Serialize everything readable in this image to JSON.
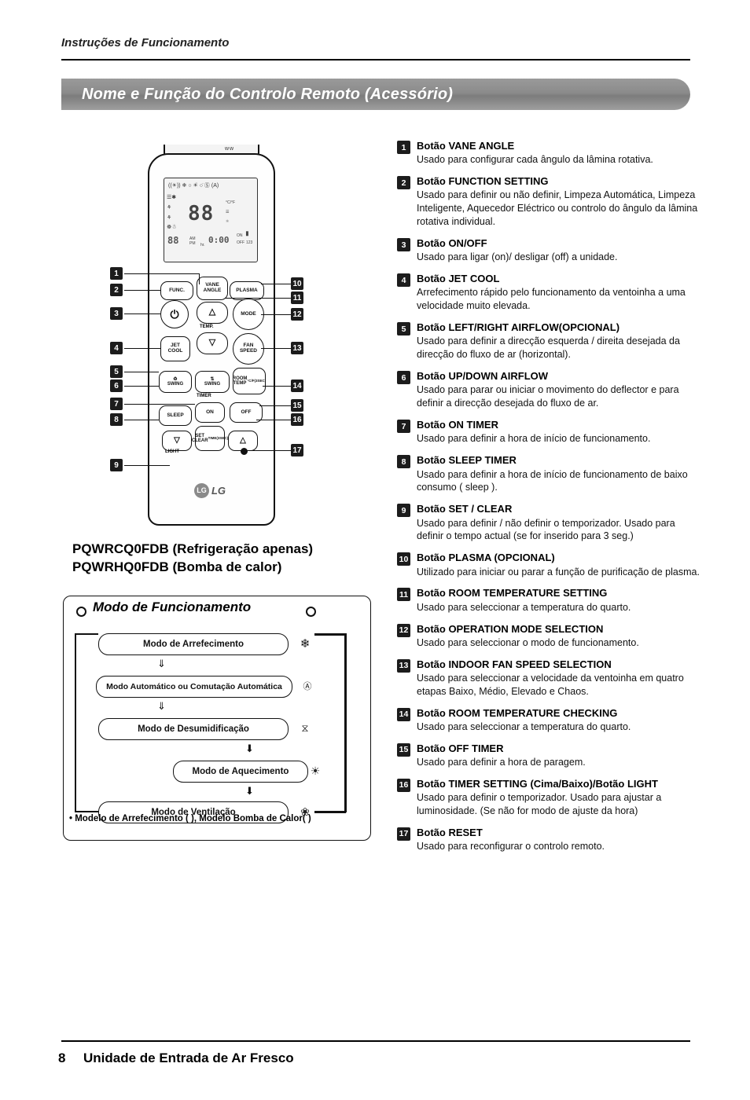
{
  "header": {
    "running_title": "Instruções de Funcionamento",
    "section_title": "Nome e Função do Controlo Remoto (Acessório)"
  },
  "footer": {
    "page_number": "8",
    "text": "Unidade de Entrada de Ar Fresco"
  },
  "remote": {
    "model_line1": "PQWRCQ0FDB (Refrigeração apenas)",
    "model_line2": "PQWRHQ0FDB (Bomba de calor)",
    "brand": "LG",
    "brand_mark": "LG",
    "lcd": {
      "main_value": "88",
      "small_value": "88",
      "unit": "°C/°F",
      "am_pm": "AM\nPM",
      "hr": "hr.",
      "time": "0:00",
      "on_label": "ON",
      "off_label": "OFF",
      "timer_numbers": "123"
    },
    "buttons": {
      "func": "FUNC.",
      "vane_angle": "VANE\nANGLE",
      "plasma": "PLASMA",
      "mode": "MODE",
      "temp": "TEMP.",
      "jet_cool": "JET\nCOOL",
      "fan_speed": "FAN\nSPEED",
      "swing": "SWING",
      "room_temp": "ROOM\nTEMP",
      "room_temp_sub": "°C/F(3SEC)",
      "timer": "TIMER",
      "on": "ON",
      "off": "OFF",
      "sleep": "SLEEP",
      "set_clear": "SET\nCLEAR",
      "set_clear_sub": "TIME(3SEC)",
      "light": "LIGHT",
      "power": "power-icon",
      "reset": "reset-hole"
    },
    "callouts": [
      "1",
      "2",
      "3",
      "4",
      "5",
      "6",
      "7",
      "8",
      "9",
      "10",
      "11",
      "12",
      "13",
      "14",
      "15",
      "16",
      "17"
    ]
  },
  "mode_diagram": {
    "title": "Modo de Funcionamento",
    "steps": [
      {
        "label": "Modo de Arrefecimento",
        "icon": "❄"
      },
      {
        "label": "Modo Automático ou Comutação Automática",
        "icon": "A"
      },
      {
        "label": "Modo de Desumidificação",
        "icon": "💧"
      },
      {
        "label": "Modo de Aquecimento",
        "icon": "☀"
      },
      {
        "label": "Modo de Ventilação",
        "icon": "✿"
      }
    ],
    "note": "• Modelo de Arrefecimento (    ), Modelo Bomba de Calor(    )"
  },
  "functions": [
    {
      "num": "1",
      "title": "Botão VANE ANGLE",
      "desc": "Usado para configurar cada ângulo da lâmina rotativa."
    },
    {
      "num": "2",
      "title": "Botão FUNCTION SETTING",
      "desc": "Usado para definir ou não definir, Limpeza Automática, Limpeza Inteligente, Aquecedor Eléctrico ou controlo do ângulo da lâmina rotativa individual."
    },
    {
      "num": "3",
      "title": "Botão ON/OFF",
      "desc": "Usado para ligar (on)/ desligar (off) a unidade."
    },
    {
      "num": "4",
      "title": "Botão JET COOL",
      "desc": "Arrefecimento rápido pelo funcionamento da ventoinha a uma velocidade muito elevada."
    },
    {
      "num": "5",
      "title": "Botão LEFT/RIGHT AIRFLOW(OPCIONAL)",
      "desc": "Usado para definir a direcção esquerda / direita desejada da direcção do fluxo de ar (horizontal)."
    },
    {
      "num": "6",
      "title": "Botão UP/DOWN AIRFLOW",
      "desc": "Usado para parar ou iniciar o movimento do deflector e para definir a direcção desejada do fluxo de ar."
    },
    {
      "num": "7",
      "title": "Botão ON TIMER",
      "desc": "Usado para definir a hora de início de funcionamento."
    },
    {
      "num": "8",
      "title": "Botão SLEEP TIMER",
      "desc": "Usado para definir a hora de início de funcionamento de baixo consumo ( sleep )."
    },
    {
      "num": "9",
      "title": "Botão SET / CLEAR",
      "desc": "Usado para definir / não definir o temporizador. Usado para definir o tempo actual (se for inserido para 3 seg.)"
    },
    {
      "num": "10",
      "title": "Botão PLASMA (OPCIONAL)",
      "desc": "Utilizado para iniciar ou parar a função de purificação de plasma."
    },
    {
      "num": "11",
      "title": "Botão ROOM TEMPERATURE SETTING",
      "desc": "Usado para seleccionar a temperatura do quarto."
    },
    {
      "num": "12",
      "title": "Botão OPERATION MODE SELECTION",
      "desc": "Usado para seleccionar o modo de funcionamento."
    },
    {
      "num": "13",
      "title": "Botão INDOOR FAN SPEED SELECTION",
      "desc": "Usado para seleccionar a velocidade da ventoinha em quatro etapas Baixo, Médio, Elevado e Chaos."
    },
    {
      "num": "14",
      "title": "Botão ROOM TEMPERATURE CHECKING",
      "desc": "Usado para seleccionar a temperatura do quarto."
    },
    {
      "num": "15",
      "title": "Botão OFF TIMER",
      "desc": "Usado para definir a hora de paragem."
    },
    {
      "num": "16",
      "title": "Botão TIMER SETTING (Cima/Baixo)/Botão LIGHT",
      "desc": "Usado para definir o temporizador. Usado para ajustar a luminosidade. (Se não for modo de ajuste da hora)"
    },
    {
      "num": "17",
      "title": "Botão RESET",
      "desc": "Usado para reconfigurar o controlo remoto."
    }
  ]
}
